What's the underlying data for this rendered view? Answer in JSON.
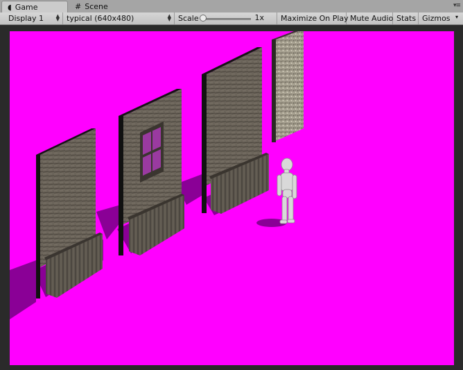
{
  "tabs": [
    {
      "label": "Game",
      "icon": "pacman-icon",
      "active": true
    },
    {
      "label": "Scene",
      "icon": "grid-icon",
      "active": false
    }
  ],
  "toolbar": {
    "display": "Display 1",
    "resolution": "typical (640x480)",
    "scale_label": "Scale",
    "scale_value": "1x",
    "scale_slider_fraction": 0.0,
    "maximize_on_play": "Maximize On Play",
    "mute_audio": "Mute Audio",
    "stats": "Stats",
    "gizmos": "Gizmos"
  },
  "colors": {
    "background": "#ff00ff",
    "wall_wood": "#6e675d",
    "wall_shadow": "#8a0096",
    "character": "#d8d8d8"
  }
}
